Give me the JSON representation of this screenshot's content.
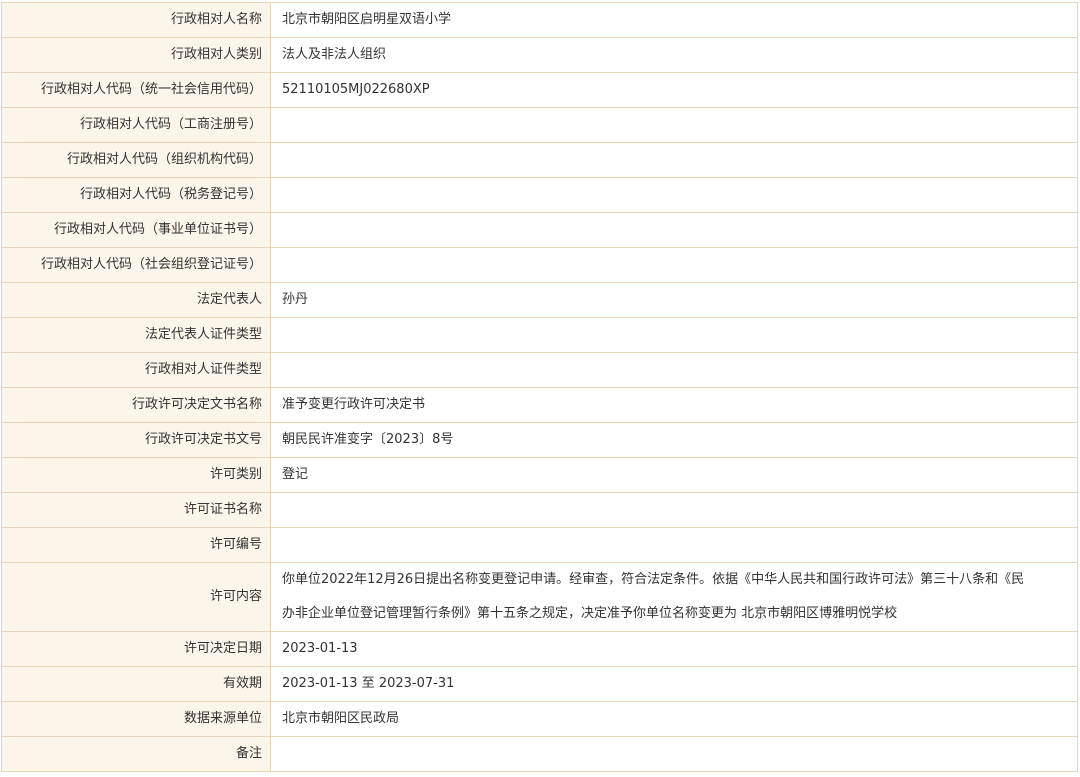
{
  "rows": [
    {
      "label": "行政相对人名称",
      "value": "北京市朝阳区启明星双语小学"
    },
    {
      "label": "行政相对人类别",
      "value": "法人及非法人组织"
    },
    {
      "label": "行政相对人代码（统一社会信用代码）",
      "value": "52110105MJ022680XP"
    },
    {
      "label": "行政相对人代码（工商注册号）",
      "value": ""
    },
    {
      "label": "行政相对人代码（组织机构代码）",
      "value": ""
    },
    {
      "label": "行政相对人代码（税务登记号）",
      "value": ""
    },
    {
      "label": "行政相对人代码（事业单位证书号）",
      "value": ""
    },
    {
      "label": "行政相对人代码（社会组织登记证号）",
      "value": ""
    },
    {
      "label": "法定代表人",
      "value": "孙丹"
    },
    {
      "label": "法定代表人证件类型",
      "value": ""
    },
    {
      "label": "行政相对人证件类型",
      "value": ""
    },
    {
      "label": "行政许可决定文书名称",
      "value": "准予变更行政许可决定书"
    },
    {
      "label": "行政许可决定书文号",
      "value": "朝民民许准变字〔2023〕8号"
    },
    {
      "label": "许可类别",
      "value": "登记"
    },
    {
      "label": "许可证书名称",
      "value": ""
    },
    {
      "label": "许可编号",
      "value": ""
    },
    {
      "label": "许可内容",
      "value_lines": [
        "你单位2022年12月26日提出名称变更登记申请。经审查，符合法定条件。依据《中华人民共和国行政许可法》第三十八条和《民",
        "办非企业单位登记管理暂行条例》第十五条之规定，决定准予你单位名称变更为 北京市朝阳区博雅明悦学校"
      ]
    },
    {
      "label": "许可决定日期",
      "value": "2023-01-13"
    },
    {
      "label": "有效期",
      "value": "2023-01-13 至 2023-07-31"
    },
    {
      "label": "数据来源单位",
      "value": "北京市朝阳区民政局"
    },
    {
      "label": "备注",
      "value": ""
    }
  ]
}
